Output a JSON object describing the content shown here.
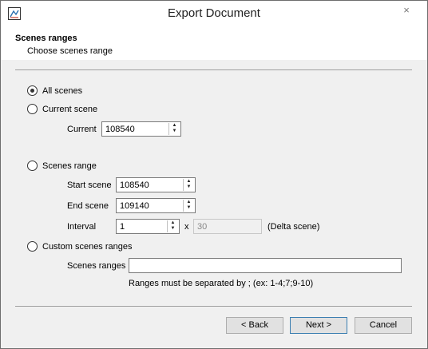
{
  "window": {
    "title": "Export Document",
    "close_glyph": "×"
  },
  "header": {
    "title": "Scenes ranges",
    "subtitle": "Choose scenes range"
  },
  "options": {
    "all_scenes": {
      "label": "All scenes",
      "checked": true
    },
    "current_scene": {
      "label": "Current scene",
      "checked": false
    },
    "scenes_range": {
      "label": "Scenes range",
      "checked": false
    },
    "custom_ranges": {
      "label": "Custom scenes ranges",
      "checked": false
    }
  },
  "current": {
    "label": "Current",
    "value": "108540"
  },
  "range": {
    "start_label": "Start scene",
    "start_value": "108540",
    "end_label": "End scene",
    "end_value": "109140",
    "interval_label": "Interval",
    "interval_value": "1",
    "times": "x",
    "delta_value": "30",
    "delta_label": "(Delta scene)"
  },
  "custom": {
    "label": "Scenes ranges",
    "value": "",
    "hint": "Ranges must be separated by ; (ex: 1-4;7;9-10)"
  },
  "spin_icons": {
    "up": "▲",
    "down": "▼"
  },
  "buttons": {
    "back": "< Back",
    "next": "Next >",
    "cancel": "Cancel"
  }
}
